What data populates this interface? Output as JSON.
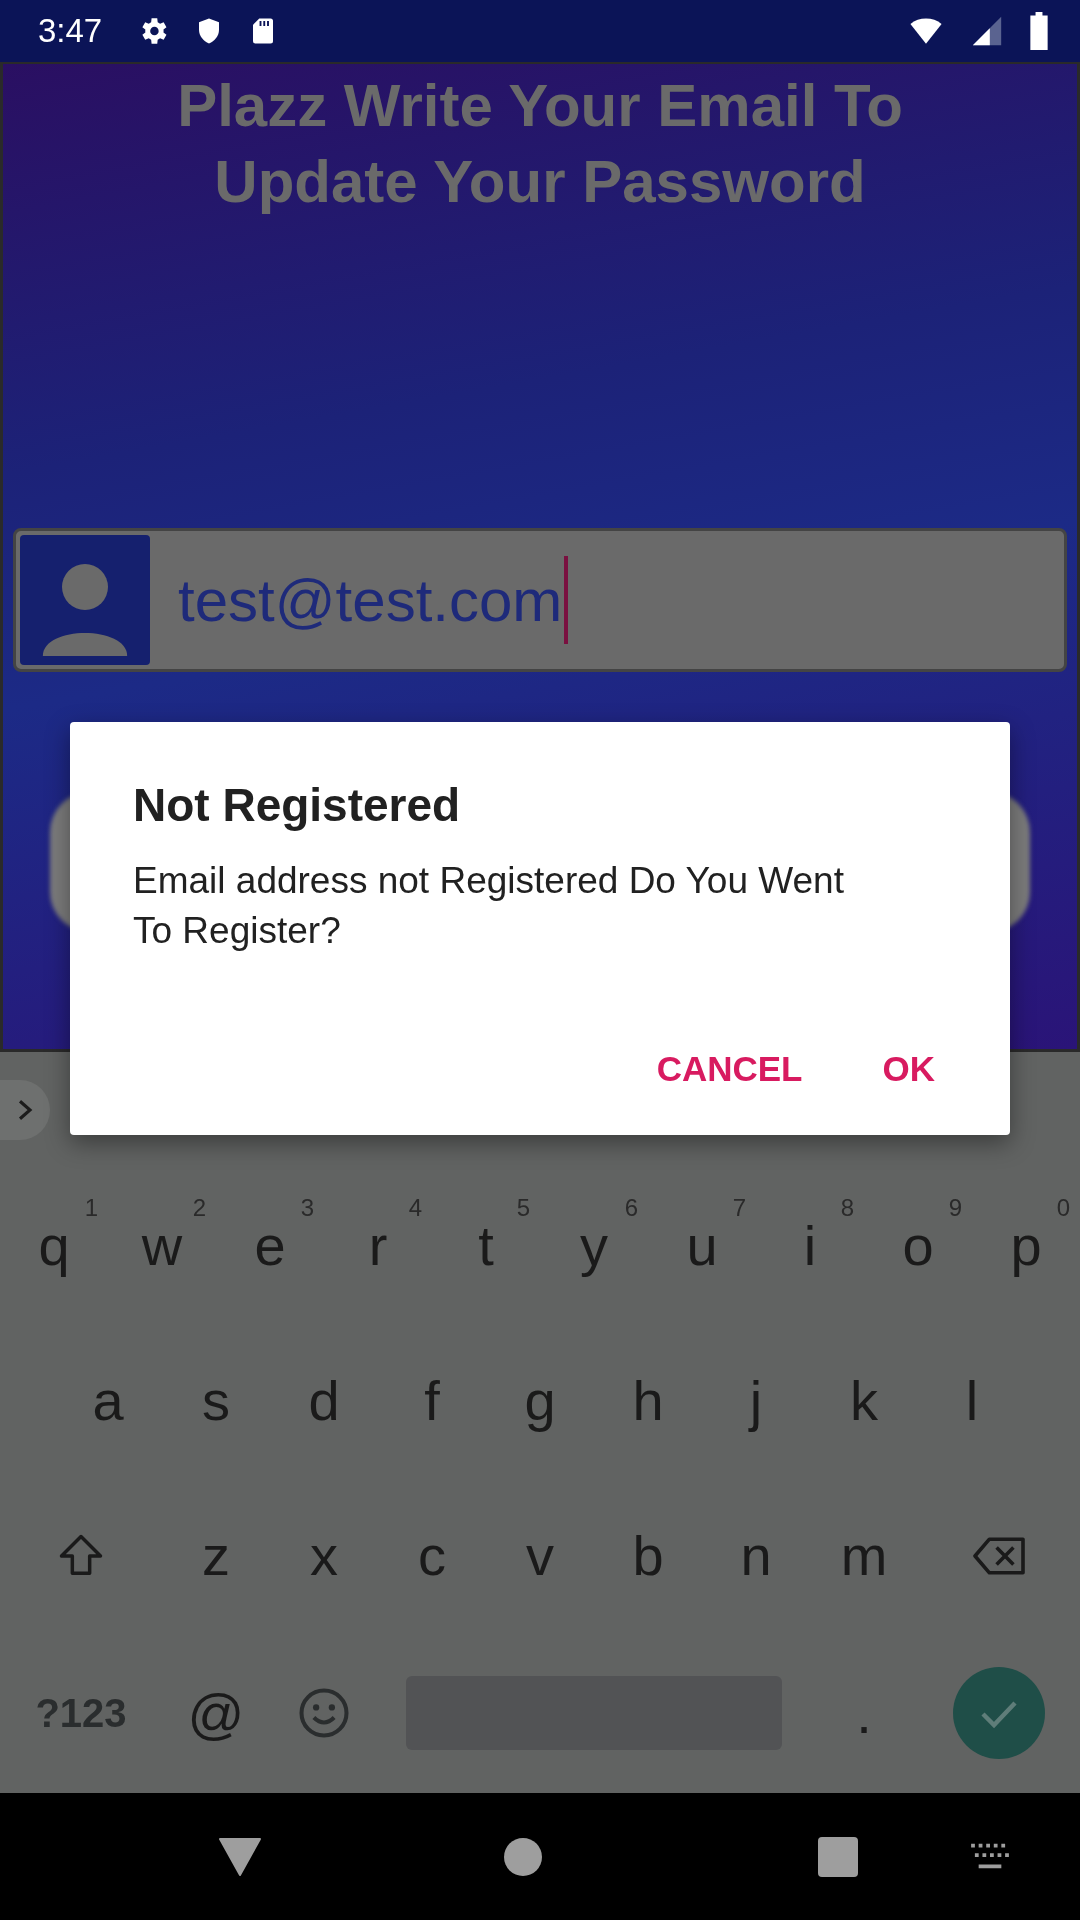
{
  "status_bar": {
    "time": "3:47"
  },
  "screen": {
    "title": "Plazz Write Your Email To Update Your Password",
    "email_field": {
      "value": "test@test.com"
    }
  },
  "dialog": {
    "title": "Not Registered",
    "message": "Email address not Registered Do You Went To Register?",
    "buttons": [
      "CANCEL",
      "OK"
    ]
  },
  "keyboard": {
    "rows": [
      {
        "keys": [
          {
            "kind": "letter",
            "label": "q",
            "hint": "1"
          },
          {
            "kind": "letter",
            "label": "w",
            "hint": "2"
          },
          {
            "kind": "letter",
            "label": "e",
            "hint": "3"
          },
          {
            "kind": "letter",
            "label": "r",
            "hint": "4"
          },
          {
            "kind": "letter",
            "label": "t",
            "hint": "5"
          },
          {
            "kind": "letter",
            "label": "y",
            "hint": "6"
          },
          {
            "kind": "letter",
            "label": "u",
            "hint": "7"
          },
          {
            "kind": "letter",
            "label": "i",
            "hint": "8"
          },
          {
            "kind": "letter",
            "label": "o",
            "hint": "9"
          },
          {
            "kind": "letter",
            "label": "p",
            "hint": "0"
          }
        ]
      },
      {
        "keys": [
          {
            "kind": "letter",
            "label": "a"
          },
          {
            "kind": "letter",
            "label": "s"
          },
          {
            "kind": "letter",
            "label": "d"
          },
          {
            "kind": "letter",
            "label": "f"
          },
          {
            "kind": "letter",
            "label": "g"
          },
          {
            "kind": "letter",
            "label": "h"
          },
          {
            "kind": "letter",
            "label": "j"
          },
          {
            "kind": "letter",
            "label": "k"
          },
          {
            "kind": "letter",
            "label": "l"
          }
        ]
      },
      {
        "keys": [
          {
            "kind": "shift"
          },
          {
            "kind": "letter",
            "label": "z"
          },
          {
            "kind": "letter",
            "label": "x"
          },
          {
            "kind": "letter",
            "label": "c"
          },
          {
            "kind": "letter",
            "label": "v"
          },
          {
            "kind": "letter",
            "label": "b"
          },
          {
            "kind": "letter",
            "label": "n"
          },
          {
            "kind": "letter",
            "label": "m"
          },
          {
            "kind": "backspace"
          }
        ]
      },
      {
        "keys": [
          {
            "kind": "symbols",
            "label": "?123"
          },
          {
            "kind": "letter",
            "label": "@"
          },
          {
            "kind": "emoji"
          },
          {
            "kind": "space"
          },
          {
            "kind": "letter",
            "label": "."
          },
          {
            "kind": "done"
          }
        ]
      }
    ]
  }
}
